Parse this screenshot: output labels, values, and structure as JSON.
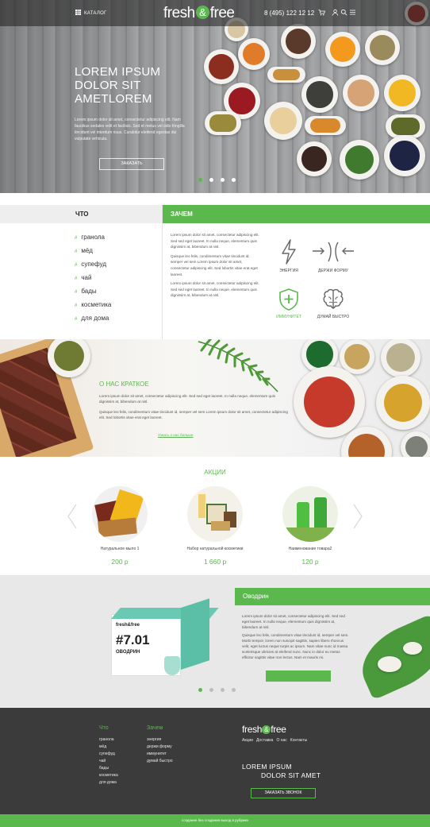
{
  "header": {
    "catalog_label": "КАТАЛОГ",
    "logo_left": "fresh",
    "logo_amp": "&",
    "logo_right": "free",
    "phone": "8 (495) 122 12 12",
    "icons": [
      "cart-icon",
      "user-icon",
      "search-icon",
      "menu-icon"
    ]
  },
  "hero": {
    "title_line1": "LOREM IPSUM",
    "title_line2": "DOLOR SIT",
    "title_line3": "AMETLOREM",
    "text": "Lorem ipsum dolor sit amet, consectetur adipiscing elit. Nam faucibus sodales velit et facilisis. Sed et metus vel odio fringilla tincidunt vel interdum risus. Curabitur eleifend egestas dui vulputate vehicula.",
    "button": "ЗАКАЗАТЬ",
    "slides": 4,
    "active_slide": 0
  },
  "what": {
    "title": "ЧТО",
    "hash": "#",
    "items": [
      "гранола",
      "мёд",
      "супефуд",
      "чай",
      "бады",
      "косметика",
      "для дома"
    ]
  },
  "why": {
    "title": "ЗАЧЕМ",
    "paragraphs": [
      "Lorem ipsum dolor sit amet, consectetur adipiscing elit. Sed sed eget laoreet. In nulla neque, elementum quis dignissim at, bibendum at nisl.",
      "Quisque leo felis, condimentum vitae tincidunt id, semper vel sem Lorem ipsum dolor sit amet, consectetur adipiscing elit. Sed lobortis vitae erat eget laoreet.",
      "Lorem ipsum dolor sit amet, consectetur adipiscing elit. Sed sed eget laoreet. In nulla neque, elementum quis dignissim at, bibendum at nisl."
    ],
    "features": [
      "ЭНЕРГИЯ",
      "ДЕРЖИ ФОРМУ",
      "ИММУНИТЕТ",
      "ДУМАЙ БЫСТРО"
    ]
  },
  "about": {
    "title": "О НАС КРАТКОЕ",
    "p1": "Lorem ipsum dolor sit amet, consectetur adipiscing elit. Sed sed eget laoreet. In nulla neque, elementum quis dignissim at, bibendum at nisl.",
    "p2": "Quisque leo felis, condimentum vitae tincidunt id, semper vel sem Lorem ipsum dolor sit amet, consectetur adipiscing elit. Sed lobortis vitae erat eget laoreet.",
    "link": "Узнать о нас больше"
  },
  "promo": {
    "title": "АКЦИИ",
    "products": [
      {
        "name": "Натуральное мыло 1",
        "price": "200 р"
      },
      {
        "name": "Набор натуральной косметики",
        "price": "1 660 р"
      },
      {
        "name": "Наименование товара2",
        "price": "120 р"
      }
    ]
  },
  "ovodrin": {
    "title": "Оводрин",
    "p1": "Lorem ipsum dolor sit amet, consectetur adipiscing elit. Sed sed eget laoreet. In nulla neque, elementum quis dignissim at, bibendum at nisl.",
    "p2": "Quisque leo felis, condimentum vitae tincidunt id, semper vel sem. Morbi tempor, lorem non suscipit sagittis, sapien libero rhoncus velit, eget luctus neque turpis ac ipsum. Nam vitae nunc id massa scelerisque ultricies at eleifend nunc. Nunc in dolor eu metus efficitur sagittis vitae non lectus. Nam et mauris mi.",
    "box_brand": "fresh&free",
    "box_number": "#7.01",
    "box_name": "ОВОДРИН",
    "slides": 4,
    "active_slide": 0
  },
  "footer": {
    "col1_title": "Что",
    "col1": [
      "гранола",
      "мёд",
      "супефуд",
      "чай",
      "бады",
      "косметика",
      "для дома"
    ],
    "col2_title": "Зачем",
    "col2": [
      "энергия",
      "держи форму",
      "иммунитет",
      "думай быстро"
    ],
    "logo": "fresh",
    "logo_amp": "&",
    "logo_right": "free",
    "nav": [
      "Акции",
      "Доставка",
      "О нас",
      "Контакты"
    ],
    "slogan_line1": "LOREM IPSUM",
    "slogan_line2": "DOLOR SIT AMET",
    "button": "ЗАКАЗАТЬ ЗВОНОК",
    "copyright": "создание без создания выход в рубрике"
  },
  "colors": {
    "accent": "#5bb84d",
    "footer": "#3b3b3b"
  }
}
